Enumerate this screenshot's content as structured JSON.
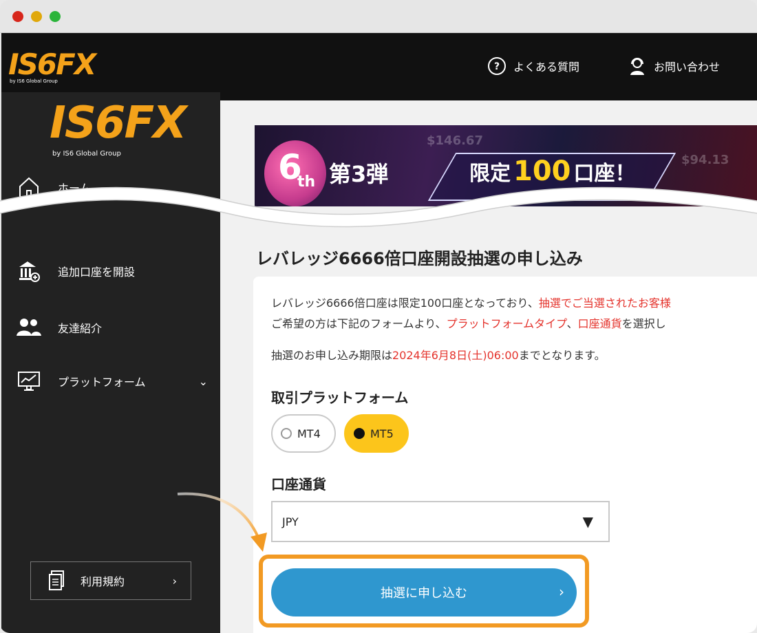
{
  "window": {
    "controls": [
      "close",
      "minimize",
      "maximize"
    ]
  },
  "brand": {
    "logo_text": "IS6FX",
    "logo_sub": "by IS6 Global Group",
    "accent": "#f4a21a"
  },
  "topnav": {
    "faq_label": "よくある質問",
    "contact_label": "お問い合わせ"
  },
  "sidebar": {
    "items": [
      {
        "label": "ホーム",
        "icon": "home-icon"
      },
      {
        "label": "追加口座を開設",
        "icon": "bank-add-icon"
      },
      {
        "label": "友達紹介",
        "icon": "users-icon"
      },
      {
        "label": "プラットフォーム",
        "icon": "monitor-chart-icon"
      }
    ],
    "terms_label": "利用規約",
    "chevron": "›",
    "expand": "⌄"
  },
  "banner": {
    "badge_num": "6",
    "badge_suffix": "th",
    "part": "第3弾",
    "limited_pre": "限定",
    "limited_num": "100",
    "limited_post": "口座！",
    "ghost_1": "$146.67",
    "ghost_2": "$94.13"
  },
  "page": {
    "title": "レバレッジ6666倍口座開設抽選の申し込み",
    "p1_a": "レバレッジ6666倍口座は限定100口座となっており、",
    "p1_b": "抽選でご当選されたお客様",
    "p2_a": "ご希望の方は下記のフォームより、",
    "p2_b": "プラットフォームタイプ",
    "p2_c": "、",
    "p2_d": "口座通貨",
    "p2_e": "を選択し",
    "p3_a": "抽選のお申し込み期限は",
    "p3_b": "2024年6月8日(土)06:00",
    "p3_c": "までとなります。",
    "highlight_color": "#e4322b"
  },
  "form": {
    "platform_label": "取引プラットフォーム",
    "platform_options": [
      "MT4",
      "MT5"
    ],
    "platform_selected": "MT5",
    "currency_label": "口座通貨",
    "currency_value": "JPY",
    "select_arrow": "▼",
    "submit_label": "抽選に申し込む",
    "submit_chevron": "›",
    "button_color": "#2f97cf",
    "selected_color": "#fcc51b"
  }
}
